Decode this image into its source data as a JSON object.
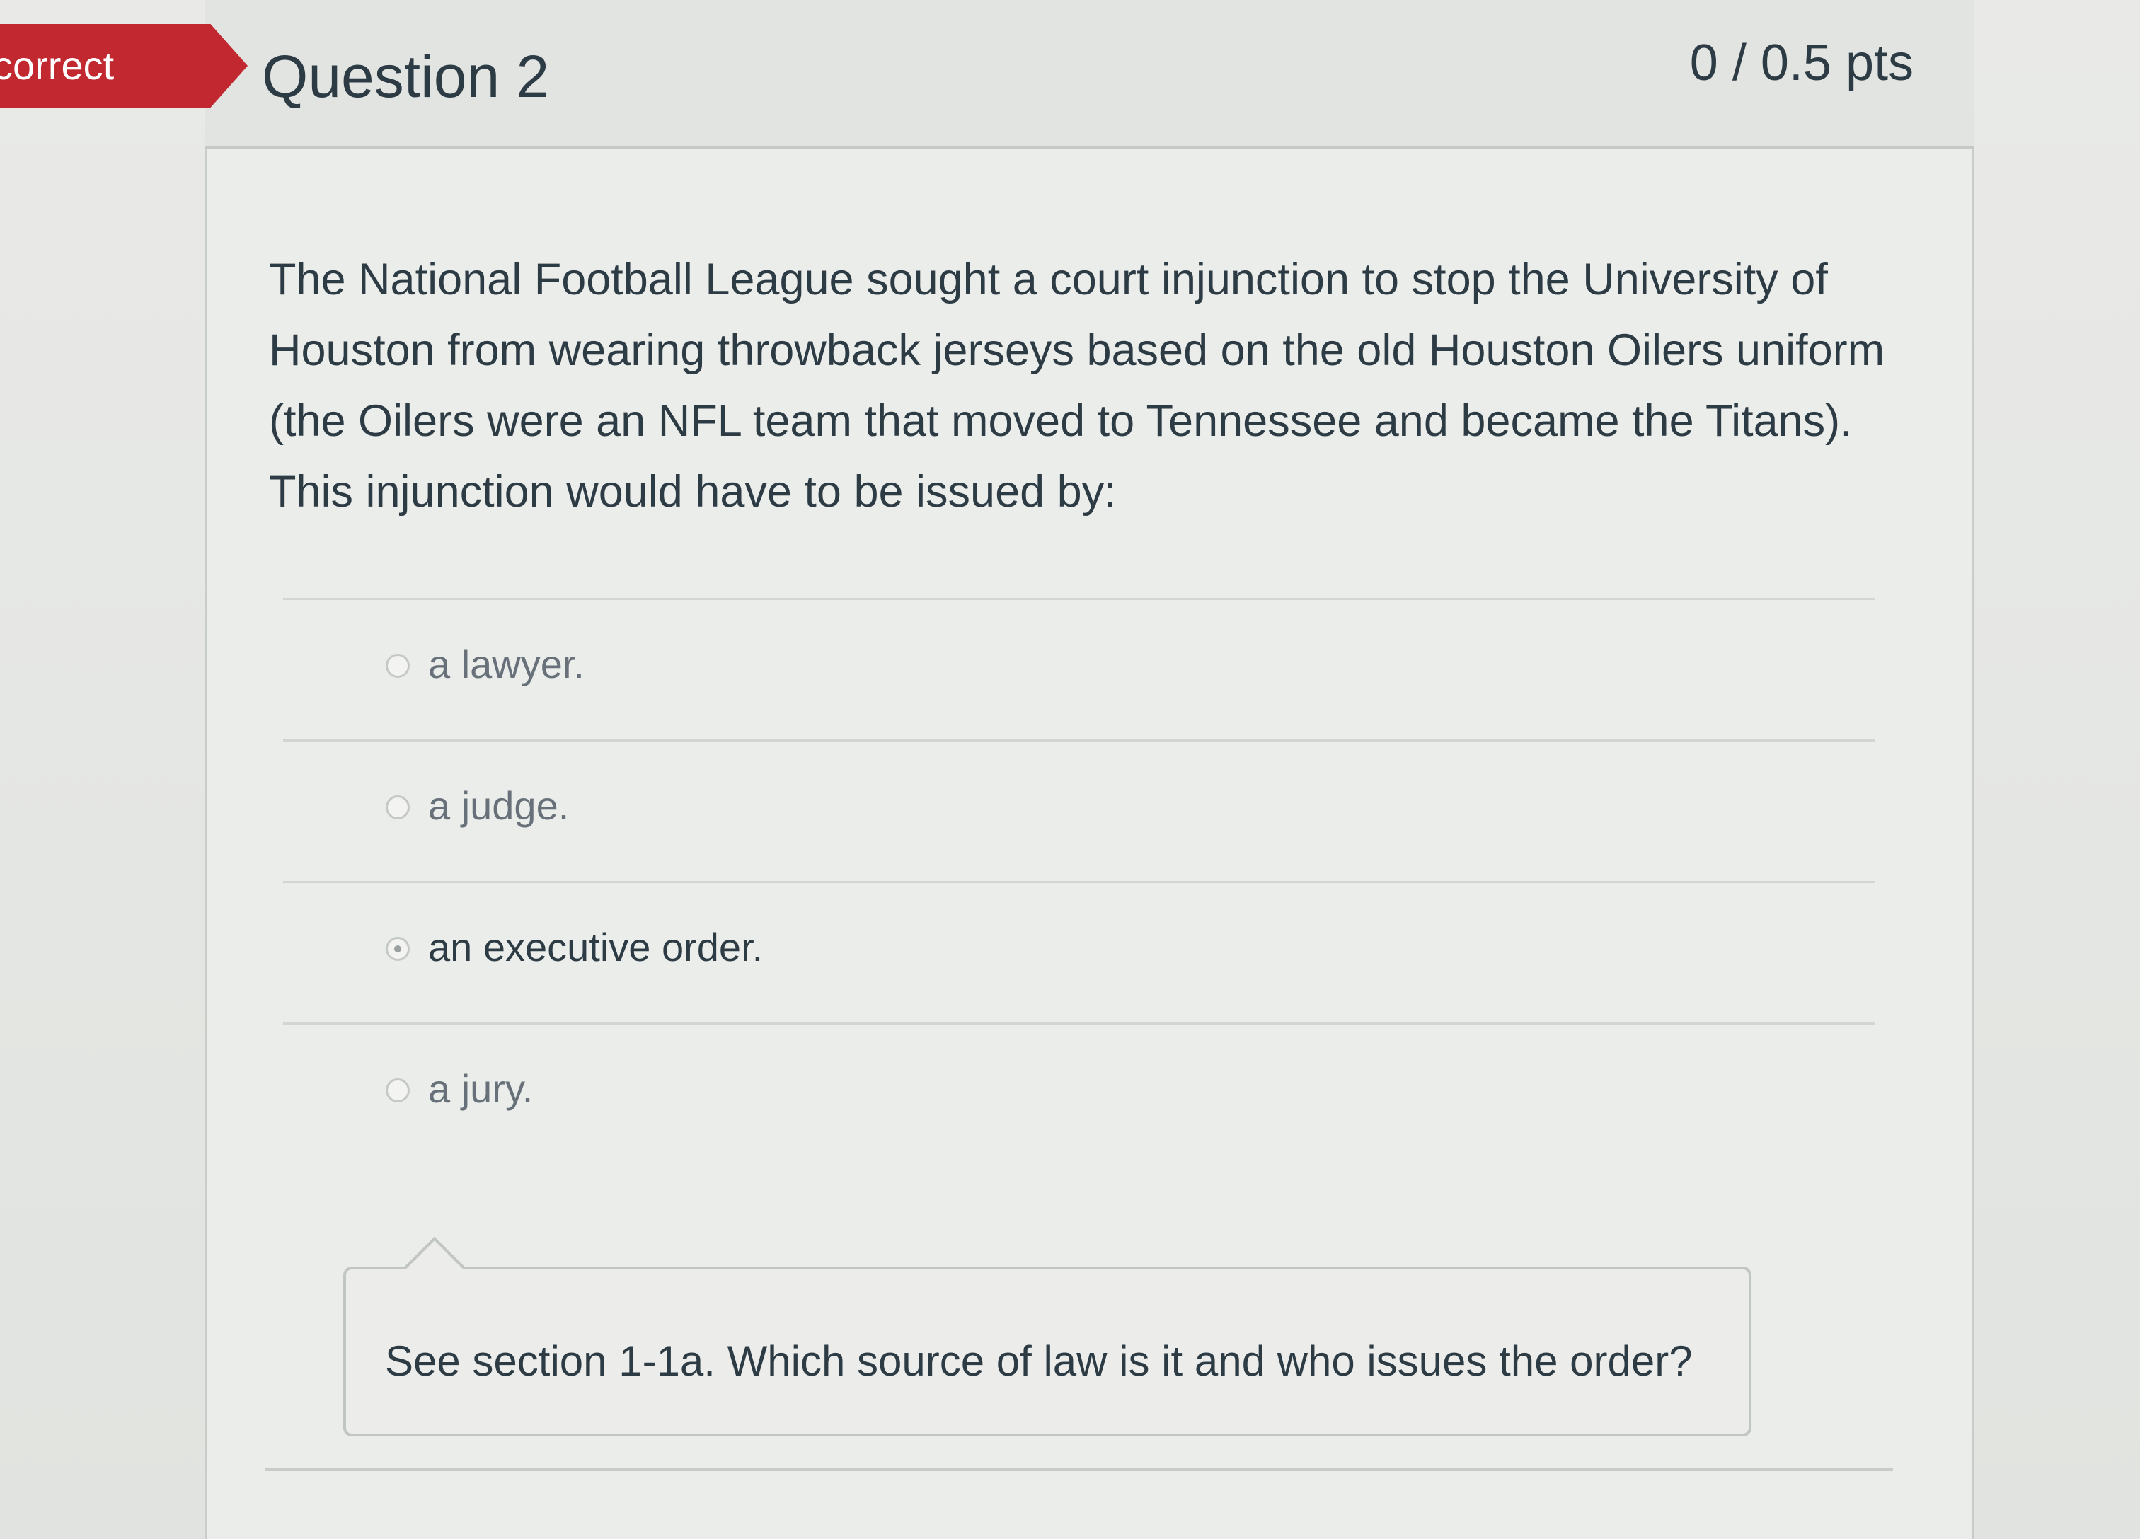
{
  "status_flag": "correct",
  "question": {
    "title": "Question 2",
    "points": "0 / 0.5 pts",
    "text": "The National Football League sought a court injunction to stop the University of Houston from wearing throwback jerseys based on the old Houston Oilers uniform (the Oilers were an NFL team that moved to Tennessee and became the Titans). This injunction would have to be issued by:"
  },
  "answers": [
    {
      "label": "a lawyer.",
      "selected": false
    },
    {
      "label": "a judge.",
      "selected": false
    },
    {
      "label": "an executive order.",
      "selected": true
    },
    {
      "label": "a jury.",
      "selected": false
    }
  ],
  "feedback": {
    "text": "See section 1-1a. Which source of law is it and who issues the order?"
  },
  "colors": {
    "incorrect_flag": "#c1282f",
    "text": "#2d3b45",
    "muted_text": "#68717a"
  }
}
